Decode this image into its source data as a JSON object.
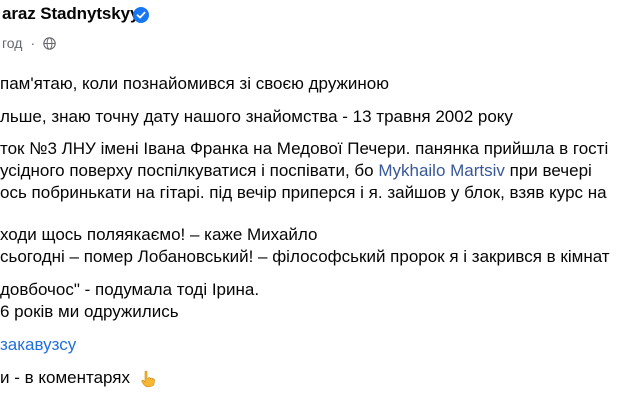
{
  "post": {
    "author": "araz Stadnytskyy",
    "time": "год",
    "separator": "·",
    "lines": {
      "l1": "пам'ятаю, коли познайомився зі своєю дружиною",
      "l2": "льше, знаю точну дату нашого знайомства - 13 травня 2002 року",
      "l3a": "ток №3 ЛНУ імені Івана Франка на Медової Печери. панянка прийшла в гості",
      "l4a": "усідного поверху поспілкуватися і поспівати, бо ",
      "l4link": "Mykhailo Martsiv",
      "l4b": " при вечері",
      "l5": "ось побринькати на гітарі. під вечір приперся і я. зайшов у блок, взяв курс на",
      "l6": "ходи щось поляякаємо! – каже Михайло",
      "l7": "сьогодні – помер Лобановський! – філософський пророк я і закрився в кімнат",
      "l8": "довбочос\" - подумала тоді Ірина.",
      "l9": "6 років ми одружились",
      "l10": "закавузсу",
      "l11": "и - в коментарях"
    }
  },
  "colors": {
    "text": "#050505",
    "meta": "#65676b",
    "mention": "#385898",
    "hashtag": "#216fdb",
    "verified": "#1877f2"
  },
  "icons": {
    "verified": "verified-badge-icon",
    "globe": "globe-icon",
    "pointing": "backhand-index-pointing-down-emoji"
  }
}
